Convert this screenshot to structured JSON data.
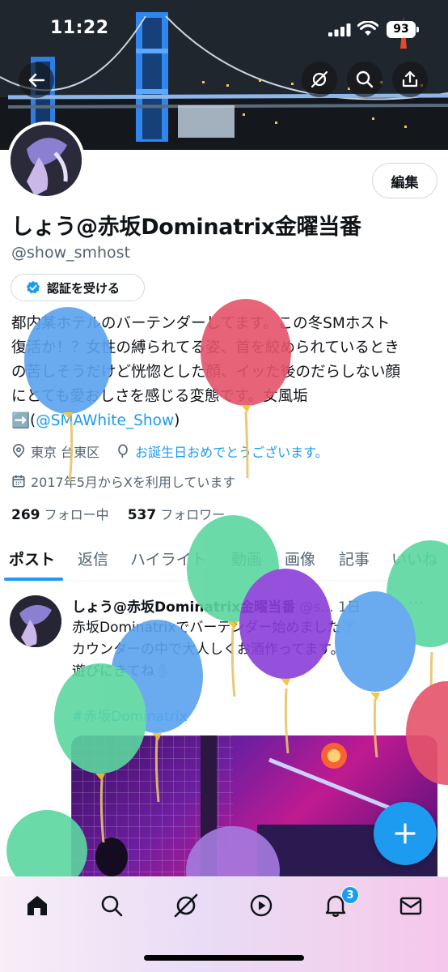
{
  "status_bar": {
    "time": "11:22",
    "battery": "93"
  },
  "profile": {
    "edit_label": "編集",
    "display_name": "しょう@赤坂Dominatrix金曜当番",
    "handle": "@show_smhost",
    "verify_label": "認証を受ける",
    "bio_lines": [
      "都内某ホテルのバーテンダーしてます。この冬SMホスト",
      "復活か！？女性の縛られてる姿、首を絞められているとき",
      "の苦しそうだけど恍惚とした顔、イッた後のだらしない顔",
      "にとても愛おしさを感じる変態です。女風垢"
    ],
    "bio_link_prefix": "➡️(",
    "bio_link": "@SMAWhite_Show",
    "bio_link_suffix": ")",
    "location": "東京 台東区",
    "birthday": "お誕生日おめでとうございます。",
    "joined": "2017年5月からXを利用しています",
    "following_count": "269",
    "following_label": "フォロー中",
    "followers_count": "537",
    "followers_label": "フォロワー"
  },
  "tabs": [
    {
      "label": "ポスト",
      "active": true
    },
    {
      "label": "返信"
    },
    {
      "label": "ハイライト"
    },
    {
      "label": "動画"
    },
    {
      "label": "画像"
    },
    {
      "label": "記事"
    },
    {
      "label": "いいね"
    }
  ],
  "post": {
    "name": "しょう@赤坂Dominatrix金曜当番",
    "handle": "@s...",
    "time": "1日",
    "more": "···",
    "lines": [
      "赤坂Dominatrixでバーテンダー始めました🍸",
      "カウンターの中で大人しくお酒作ってます。",
      "遊びにきてね✋🏻"
    ],
    "hashtag": "#赤坂Dominatrix"
  },
  "bottom_nav": {
    "notification_badge": "3"
  },
  "icons": [
    "back-arrow-icon",
    "grok-icon",
    "search-icon",
    "share-icon",
    "verified-check-icon",
    "location-pin-icon",
    "balloon-icon",
    "calendar-icon",
    "compose-plus-icon",
    "home-icon",
    "explore-search-icon",
    "grok-nav-icon",
    "video-icon",
    "bell-icon",
    "mail-icon"
  ],
  "colors": {
    "accent": "#1d9bf0",
    "text": "#0f1419",
    "secondary": "#536471"
  }
}
